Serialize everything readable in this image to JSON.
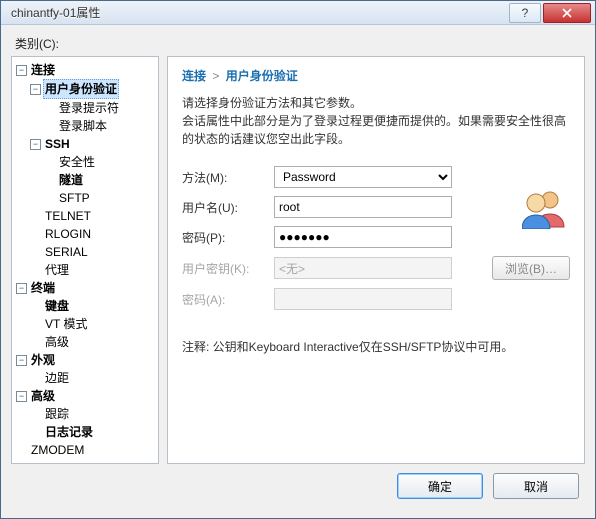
{
  "window": {
    "title": "chinantfy-01属性"
  },
  "category_label": "类别(C):",
  "tree": {
    "connection": "连接",
    "auth": "用户身份验证",
    "login_prompt": "登录提示符",
    "login_script": "登录脚本",
    "ssh": "SSH",
    "security": "安全性",
    "tunnel": "隧道",
    "sftp": "SFTP",
    "telnet": "TELNET",
    "rlogin": "RLOGIN",
    "serial": "SERIAL",
    "proxy": "代理",
    "terminal": "终端",
    "keyboard": "键盘",
    "vtmode": "VT 模式",
    "advanced1": "高级",
    "appearance": "外观",
    "margin": "边距",
    "advanced2": "高级",
    "trace": "跟踪",
    "logging": "日志记录",
    "zmodem": "ZMODEM"
  },
  "breadcrumb": {
    "root": "连接",
    "sep": ">",
    "leaf": "用户身份验证"
  },
  "desc": {
    "line1": "请选择身份验证方法和其它参数。",
    "line2": "会话属性中此部分是为了登录过程更便捷而提供的。如果需要安全性很高的状态的话建议您空出此字段。"
  },
  "form": {
    "method_label": "方法(M):",
    "method_value": "Password",
    "user_label": "用户名(U):",
    "user_value": "root",
    "pass_label": "密码(P):",
    "pass_value": "●●●●●●●",
    "userkey_label": "用户密钥(K):",
    "userkey_value": "<无>",
    "browse_label": "浏览(B)…",
    "passA_label": "密码(A):"
  },
  "note": "注释: 公钥和Keyboard Interactive仅在SSH/SFTP协议中可用。",
  "footer": {
    "ok": "确定",
    "cancel": "取消"
  }
}
